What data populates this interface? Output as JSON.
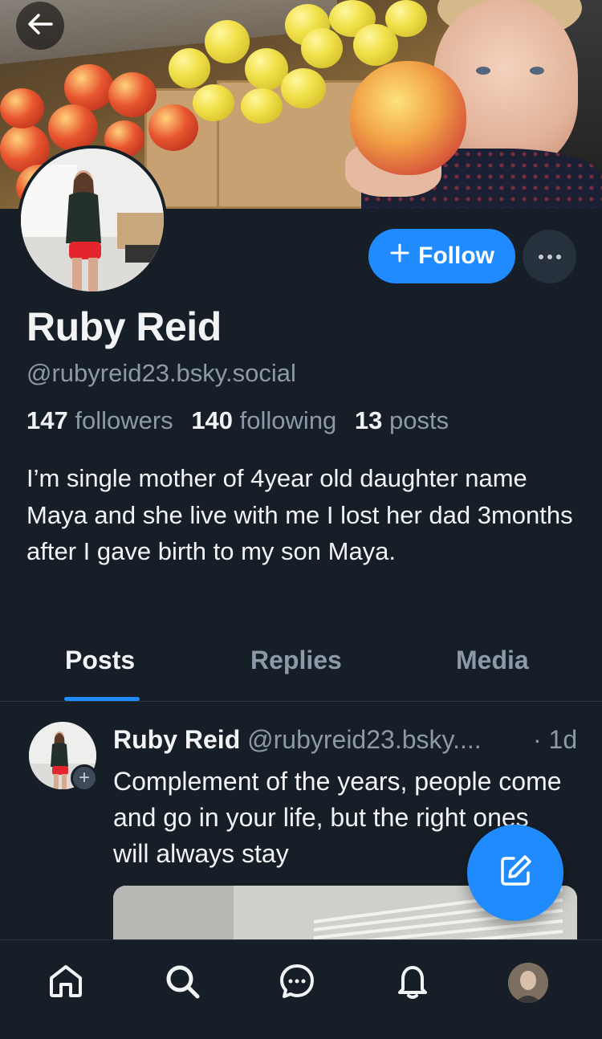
{
  "profile": {
    "name": "Ruby Reid",
    "handle": "@rubyreid23.bsky.social",
    "followers_count": "147",
    "followers_label": "followers",
    "following_count": "140",
    "following_label": "following",
    "posts_count": "13",
    "posts_label": "posts",
    "bio": "I’m single mother of 4year old daughter name Maya and she live with me I lost her dad 3months after I gave birth to my son Maya."
  },
  "actions": {
    "follow_label": "Follow",
    "follow_icon": "plus-icon",
    "more_icon": "ellipsis-icon"
  },
  "tabs": [
    {
      "label": "Posts",
      "active": true
    },
    {
      "label": "Replies",
      "active": false
    },
    {
      "label": "Media",
      "active": false
    }
  ],
  "post": {
    "author": "Ruby Reid",
    "handle": "@rubyreid23.bsky....",
    "time": "· 1d",
    "text": "Complement of the years, people come and go in your life, but the right ones will always stay"
  },
  "nav": [
    "home-icon",
    "search-icon",
    "chat-icon",
    "bell-icon",
    "profile-avatar"
  ],
  "colors": {
    "background": "#161e27",
    "accent": "#208bfe",
    "muted": "#8d99a8",
    "text": "#f1f3f5"
  }
}
